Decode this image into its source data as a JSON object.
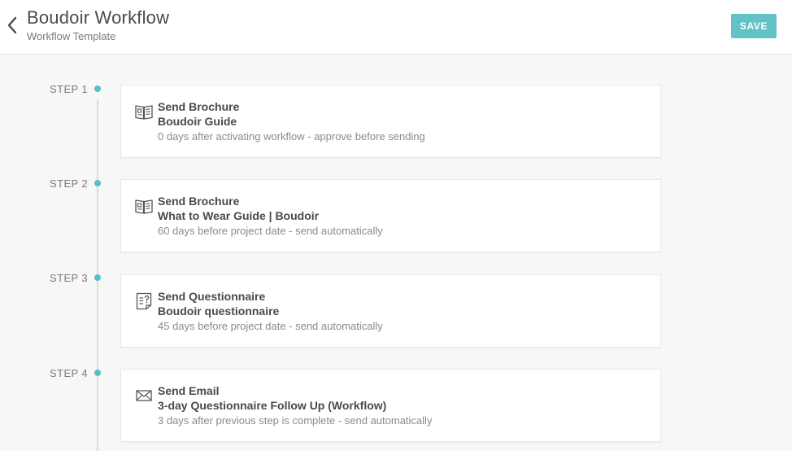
{
  "header": {
    "title": "Boudoir Workflow",
    "subtitle": "Workflow Template",
    "save_label": "SAVE",
    "back_icon": "chevron-left-icon"
  },
  "colors": {
    "accent": "#62c2c8",
    "timeline_dot": "#56c0c7",
    "background": "#f7f7f7"
  },
  "steps": [
    {
      "label": "STEP 1",
      "icon": "brochure-icon",
      "action": "Send Brochure",
      "name": "Boudoir Guide",
      "timing": "0 days after activating workflow - approve before sending"
    },
    {
      "label": "STEP 2",
      "icon": "brochure-icon",
      "action": "Send Brochure",
      "name": "What to Wear Guide | Boudoir",
      "timing": "60 days before project date  - send automatically"
    },
    {
      "label": "STEP 3",
      "icon": "questionnaire-icon",
      "action": "Send Questionnaire",
      "name": "Boudoir questionnaire",
      "timing": "45 days before project date  - send automatically"
    },
    {
      "label": "STEP 4",
      "icon": "email-icon",
      "action": "Send Email",
      "name": "3-day Questionnaire Follow Up (Workflow)",
      "timing": "3 days after previous step is complete - send automatically"
    }
  ]
}
